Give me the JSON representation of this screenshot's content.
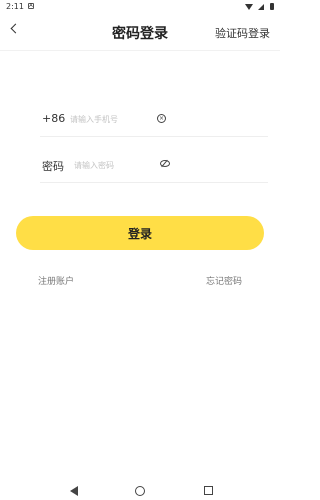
{
  "status_bar": {
    "time": "2:11",
    "notification_glyph": "A"
  },
  "header": {
    "title": "密码登录",
    "switch_link": "验证码登录"
  },
  "phone_field": {
    "prefix": "+86",
    "placeholder": "请输入手机号",
    "value": ""
  },
  "password_field": {
    "label": "密码",
    "placeholder": "请输入密码",
    "value": ""
  },
  "login_button": {
    "label": "登录",
    "color": "#ffde46"
  },
  "links": {
    "register": "注册账户",
    "forgot_password": "忘记密码"
  },
  "icons": {
    "back": "back-arrow-icon",
    "clear": "clear-circle-icon",
    "visibility": "eye-off-icon"
  }
}
